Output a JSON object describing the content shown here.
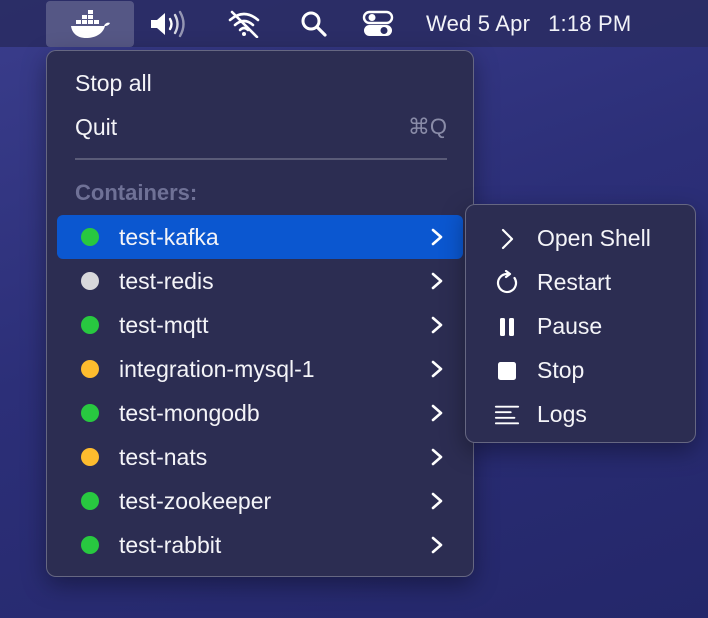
{
  "menubar": {
    "date": "Wed 5 Apr",
    "time": "1:18 PM",
    "icons": [
      "docker-icon",
      "speaker-icon",
      "wifi-off-icon",
      "search-icon",
      "control-center-icon"
    ]
  },
  "menu": {
    "stop_all": "Stop all",
    "quit": "Quit",
    "quit_shortcut": "⌘Q",
    "section_title": "Containers:",
    "containers": [
      {
        "name": "test-kafka",
        "status_color": "#28c840"
      },
      {
        "name": "test-redis",
        "status_color": "#d8d8dc"
      },
      {
        "name": "test-mqtt",
        "status_color": "#28c840"
      },
      {
        "name": "integration-mysql-1",
        "status_color": "#febc2e"
      },
      {
        "name": "test-mongodb",
        "status_color": "#28c840"
      },
      {
        "name": "test-nats",
        "status_color": "#febc2e"
      },
      {
        "name": "test-zookeeper",
        "status_color": "#28c840"
      },
      {
        "name": "test-rabbit",
        "status_color": "#28c840"
      }
    ],
    "selected": "test-kafka"
  },
  "submenu": {
    "items": [
      {
        "label": "Open Shell",
        "icon": "chevron-right-icon"
      },
      {
        "label": "Restart",
        "icon": "restart-icon"
      },
      {
        "label": "Pause",
        "icon": "pause-icon"
      },
      {
        "label": "Stop",
        "icon": "stop-icon"
      },
      {
        "label": "Logs",
        "icon": "logs-icon"
      }
    ]
  },
  "colors": {
    "selection": "#0b57d0",
    "running": "#28c840",
    "paused": "#febc2e",
    "stopped": "#d8d8dc"
  }
}
